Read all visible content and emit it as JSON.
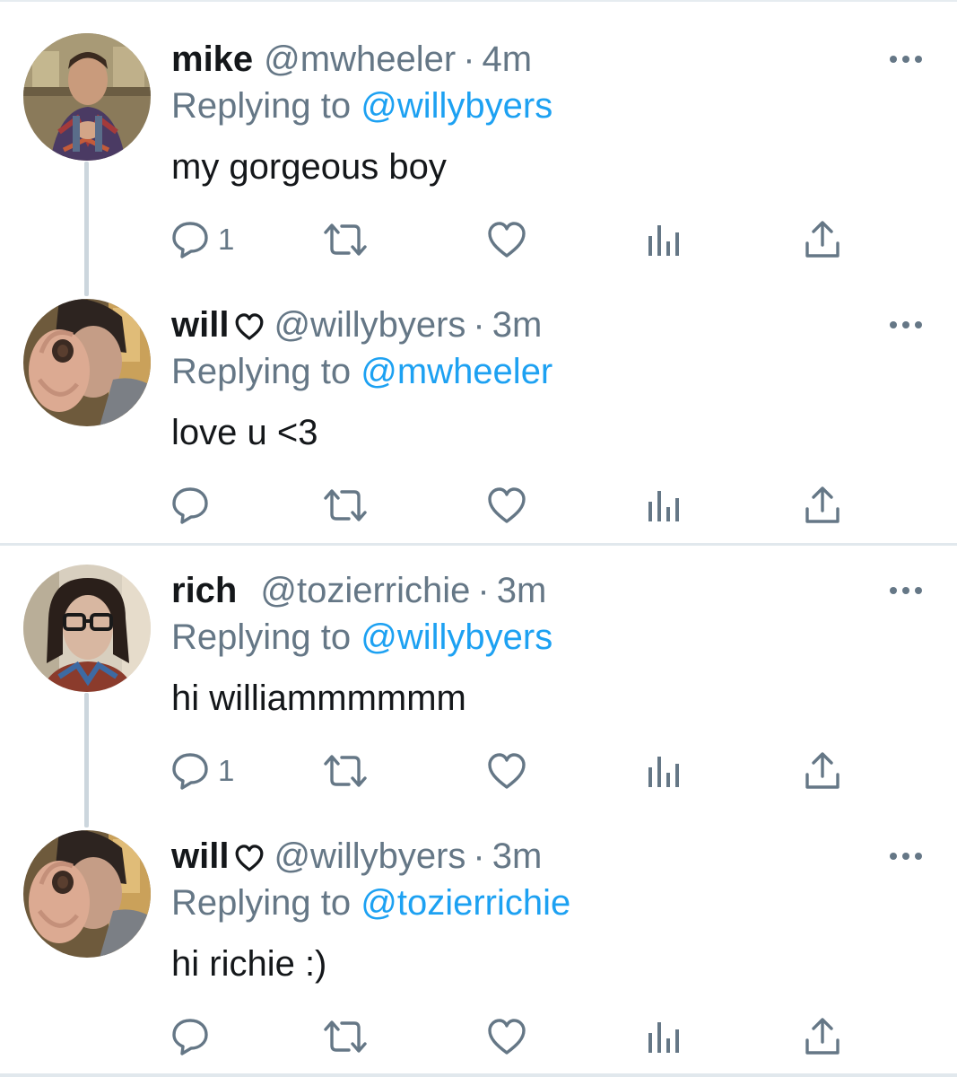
{
  "tweets": [
    {
      "name": "mike",
      "verified_heart": false,
      "handle": "@mwheeler",
      "separator": "·",
      "time": "4m",
      "replying_prefix": "Replying to",
      "replying_to": "@willybyers",
      "text": "my gorgeous boy",
      "reply_count": "1"
    },
    {
      "name": "will",
      "verified_heart": true,
      "handle": "@willybyers",
      "separator": "·",
      "time": "3m",
      "replying_prefix": "Replying to",
      "replying_to": "@mwheeler",
      "text": "love u <3",
      "reply_count": ""
    },
    {
      "name": "rich",
      "verified_heart": false,
      "handle": "@tozierrichie",
      "separator": "·",
      "time": "3m",
      "replying_prefix": "Replying to",
      "replying_to": "@willybyers",
      "text": "hi williammmmmm",
      "reply_count": "1"
    },
    {
      "name": "will",
      "verified_heart": true,
      "handle": "@willybyers",
      "separator": "·",
      "time": "3m",
      "replying_prefix": "Replying to",
      "replying_to": "@tozierrichie",
      "text": "hi richie :)",
      "reply_count": ""
    }
  ],
  "icons": {
    "more": "more-horizontal-icon",
    "reply": "reply-bubble-icon",
    "retweet": "retweet-icon",
    "like": "heart-outline-icon",
    "analytics": "analytics-bars-icon",
    "share": "share-upload-icon",
    "name_badge": "heart-outline-icon"
  },
  "colors": {
    "text": "#14171a",
    "secondary": "#657786",
    "link": "#1da1f2",
    "divider": "#e1e8ed",
    "thread_line": "#ccd6dd"
  }
}
